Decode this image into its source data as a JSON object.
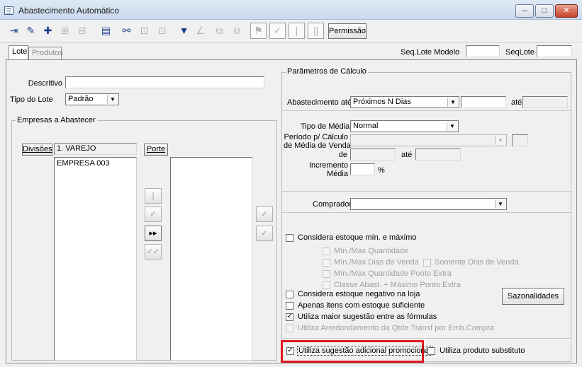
{
  "window": {
    "title": "Abastecimento Automático",
    "minimize": "–",
    "maximize": "□",
    "close": "✕"
  },
  "toolbar": {
    "permissao_label": "Permissão",
    "icons": [
      "exit-icon",
      "edit-icon",
      "add-icon",
      "tree-icon",
      "tree2-icon",
      "ledger-icon",
      "binoculars-icon",
      "grid-icon",
      "grid2-icon",
      "filter-icon",
      "chart-icon",
      "copy-icon",
      "copy2-icon",
      "flag-icon",
      "check-icon",
      "pipe-icon",
      "double-pipe-icon"
    ]
  },
  "tabs": {
    "lote": "Lote",
    "produtos": "Produtos"
  },
  "header": {
    "seq_lote_modelo_label": "Seq.Lote Modelo",
    "seq_lote_modelo_value": "",
    "seq_lote_label": "SeqLote",
    "seq_lote_value": ""
  },
  "left": {
    "descritivo_label": "Descritivo",
    "descritivo_value": "",
    "tipo_lote_label": "Tipo do Lote",
    "tipo_lote_value": "Padrão",
    "empresas_group": "Empresas a Abastecer",
    "divisoes_button": "Divisões",
    "divisao_value": "1. VAREJO",
    "porte_button": "Porte",
    "empresas_list": [
      "EMPRESA 003"
    ],
    "porte_list": []
  },
  "params": {
    "group_title": "Parâmetros de Cálculo",
    "abastecimento_label": "Abastecimento até",
    "abastecimento_value": "Próximos N Dias",
    "abastecimento_num": "",
    "ate_label": "até",
    "ate_value": "",
    "tipo_media_label": "Tipo de Média",
    "tipo_media_value": "Normal",
    "periodo_label_1": "Período p/ Cálculo",
    "periodo_label_2": "de Média de Venda",
    "periodo_value": "",
    "de_label": "de",
    "de_value": "",
    "ate2_label": "até",
    "ate2_value": "",
    "incremento_label_1": "Incremento",
    "incremento_label_2": "Média",
    "incremento_value": "",
    "percent": "%",
    "comprador_label": "Comprador",
    "comprador_value": ""
  },
  "checks": {
    "considera_min_max": "Considera estoque mín. e máximo",
    "min_max_qtd": "Mín./Max Quantidade",
    "min_max_dias": "Mín./Max Dias de Venda",
    "somente_dias": "Somente Dias de Venda",
    "min_max_qtd_ponto": "Mín./Max Quantidade Ponto Extra",
    "classe_abast": "Classe Abast. + Máximo Ponto Extra",
    "considera_negativo": "Considera estoque negativo na loja",
    "apenas_itens": "Apenas itens com estoque suficiente",
    "utiliza_maior": "Utiliza maior sugestão entre as fórmulas",
    "utiliza_arred": "Utiliza Arredondamento da Qtde Transf por Emb.Compra",
    "utiliza_adicional": "Utiliza sugestão adicional promocional",
    "utiliza_substituto": "Utiliza produto substituto",
    "sazonalidades_button": "Sazonalidades",
    "checked_mark": "✓"
  },
  "colors": {
    "highlight": "#e0141e",
    "title_bg": "#c9d9ee"
  }
}
